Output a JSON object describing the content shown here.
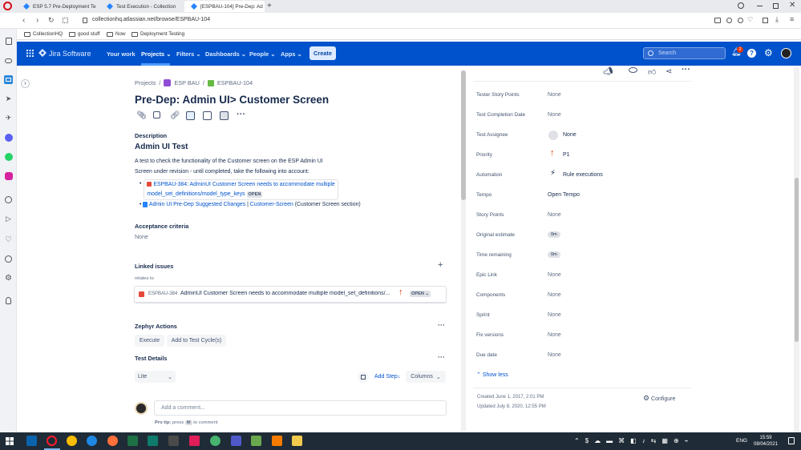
{
  "browser": {
    "tabs": [
      {
        "title": "ESP 5.7 Pre-Deployment Te"
      },
      {
        "title": "Test Execution - Collection"
      },
      {
        "title": "[ESPBAU-104] Pre-Dep: Ad"
      }
    ],
    "new_tab": "+",
    "url": "collectionhq.atlassian.net/browse/ESPBAU-104",
    "bookmarks": [
      "CollectionHQ",
      "good stuff",
      "Now",
      "Deployment Testing"
    ]
  },
  "jira_nav": {
    "product": "Jira Software",
    "items": [
      "Your work",
      "Projects",
      "Filters",
      "Dashboards",
      "People",
      "Apps"
    ],
    "create": "Create",
    "search_placeholder": "Search",
    "notification_count": "2"
  },
  "breadcrumb": {
    "projects": "Projects",
    "project": "ESP BAU",
    "issue_key": "ESPBAU-104"
  },
  "issue": {
    "title": "Pre-Dep: Admin UI> Customer Screen",
    "description_label": "Description",
    "description_heading": "Admin UI Test",
    "description_line1": "A test to check the functionality of the Customer screen on the ESP Admin UI",
    "description_line2": "Screen under revision - until completed, take the following into account:",
    "bullet1_text_a": "ESPBAU-384: AdminUI Customer Screen needs to accommodate multiple",
    "bullet1_text_b": "model_set_definitions/model_type_keys",
    "bullet1_status": "OPEN",
    "bullet2_link": "Admin UI Pre-Dep Suggested Changes",
    "bullet2_sep": " | ",
    "bullet2_link2": "Customer-Screen",
    "bullet2_suffix": " (Customer Screen section)",
    "acceptance_label": "Acceptance criteria",
    "acceptance_value": "None",
    "linked_label": "Linked issues",
    "relates_to": "relates to",
    "linked_key": "ESPBAU-384",
    "linked_summary": "AdminUI Customer Screen needs to accommodate multiple model_set_definitions/...",
    "linked_status": "OPEN",
    "zephyr_label": "Zephyr Actions",
    "execute": "Execute",
    "add_to_cycle": "Add to Test Cycle(s)",
    "test_details": "Test Details",
    "lite": "Lite",
    "add_step": "Add Step",
    "columns": "Columns",
    "comment_placeholder": "Add a comment...",
    "protip_a": "Pro tip:",
    "protip_b": "press",
    "protip_key": "M",
    "protip_c": "to comment"
  },
  "fields": [
    {
      "label": "Tester Story Points",
      "value": "None"
    },
    {
      "label": "Test Completion Date",
      "value": "None"
    },
    {
      "label": "Test Assignee",
      "value": "None"
    },
    {
      "label": "Priority",
      "value": "P1"
    },
    {
      "label": "Automation",
      "value": "Rule executions"
    },
    {
      "label": "Tempo",
      "value": "Open Tempo"
    },
    {
      "label": "Story Points",
      "value": "None"
    },
    {
      "label": "Original estimate",
      "value": "0m"
    },
    {
      "label": "Time remaining",
      "value": "0m"
    },
    {
      "label": "Epic Link",
      "value": "None"
    },
    {
      "label": "Components",
      "value": "None"
    },
    {
      "label": "Sprint",
      "value": "None"
    },
    {
      "label": "Fix versions",
      "value": "None"
    },
    {
      "label": "Due date",
      "value": "None"
    }
  ],
  "show_less": "Show less",
  "created": "Created June 1, 2017, 2:01 PM",
  "updated": "Updated July 8, 2020, 12:55 PM",
  "configure": "Configure",
  "taskbar": {
    "lang": "ENG",
    "time": "15:59",
    "date": "08/04/2021"
  },
  "colors": {
    "jira_blue": "#0052cc",
    "priority_red": "#de350b",
    "bug_red": "#e5493a"
  }
}
